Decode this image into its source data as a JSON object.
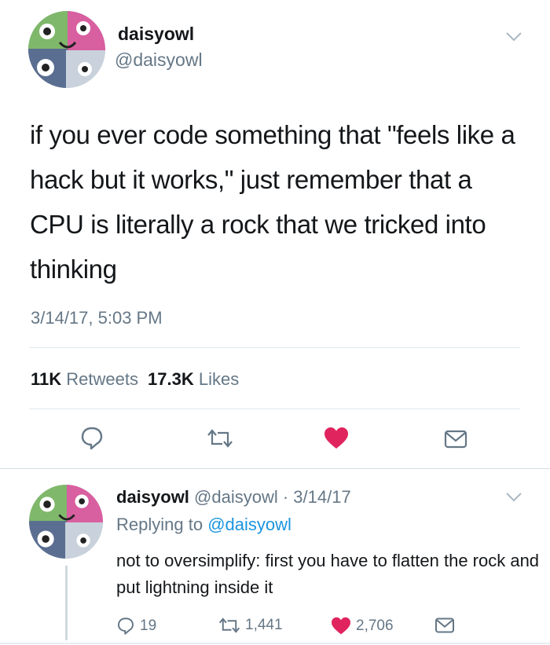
{
  "colors": {
    "text": "#14171a",
    "muted": "#657786",
    "link": "#1b95e0",
    "like": "#e0245e",
    "divider": "#e1e8ed"
  },
  "icons": {
    "reply": "reply-icon",
    "retweet": "retweet-icon",
    "like": "heart-icon",
    "message": "envelope-icon",
    "menu": "chevron-down-icon",
    "avatar": "avatar-illustration"
  },
  "tweet": {
    "name": "daisyowl",
    "handle": "@daisyowl",
    "text": "if you ever code something that \"feels like a hack but it works,\" just remember that a CPU is literally a rock that we tricked into thinking",
    "timestamp": "3/14/17, 5:03 PM",
    "retweets_count": "11K",
    "retweets_label": "Retweets",
    "likes_count": "17.3K",
    "likes_label": "Likes",
    "liked": true
  },
  "reply": {
    "name": "daisyowl",
    "handle_date": "@daisyowl · 3/14/17",
    "replying_prefix": "Replying to",
    "replying_to": "@daisyowl",
    "text": "not to oversimplify: first you have to flatten the rock and put lightning inside it",
    "reply_count": "19",
    "retweet_count": "1,441",
    "like_count": "2,706"
  }
}
